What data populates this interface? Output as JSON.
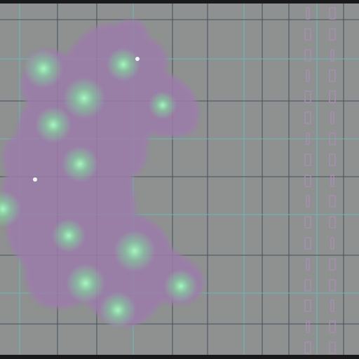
{
  "image": {
    "description_visible_text": "",
    "colors": {
      "background": "#8e9190",
      "grid_line": "#4c5560",
      "grid_line_teal": "#6fb6b4",
      "blob": "#9a78a6",
      "glow": "#7fe09a",
      "frame": "#1a1a1c"
    }
  },
  "icons": [
    "blob-icon",
    "glow-icon"
  ]
}
